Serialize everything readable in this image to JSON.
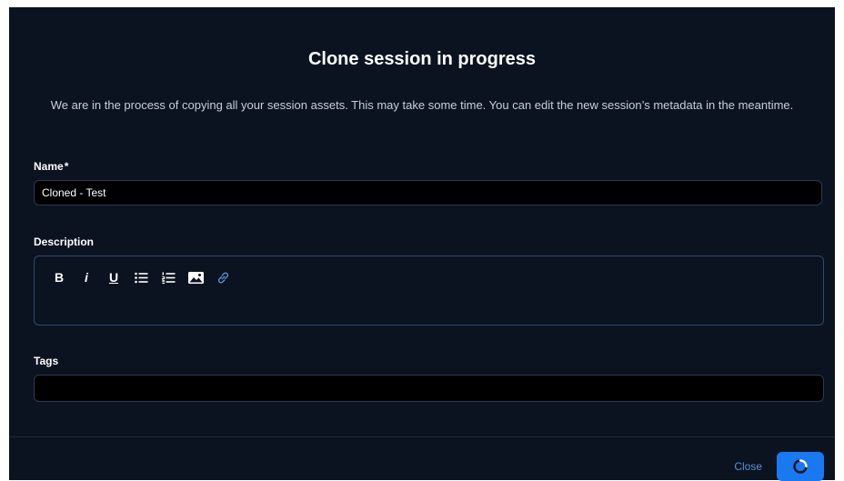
{
  "dialog": {
    "title": "Clone session in progress",
    "message": "We are in the process of copying all your session assets. This may take some time. You can edit the new session’s metadata in the meantime."
  },
  "form": {
    "name": {
      "label": "Name",
      "required_mark": "*",
      "value": "Cloned - Test"
    },
    "description": {
      "label": "Description",
      "value": "",
      "toolbar": {
        "bold": "B",
        "italic": "i",
        "underline": "U",
        "icons": [
          "bulleted-list-icon",
          "numbered-list-icon",
          "image-icon",
          "link-icon"
        ]
      }
    },
    "tags": {
      "label": "Tags",
      "value": ""
    }
  },
  "footer": {
    "close_label": "Close",
    "primary_state": "loading"
  },
  "colors": {
    "background": "#0b1320",
    "input_bg": "#000000",
    "accent": "#1a79f0",
    "link": "#5d8fd6"
  }
}
